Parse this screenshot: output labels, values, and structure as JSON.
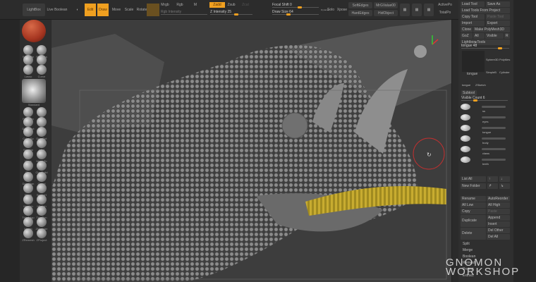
{
  "shelf": {
    "lightbox": "LightBox",
    "live_boolean": "Live Boolean",
    "edit": "Edit",
    "draw": "Draw",
    "move": "Move",
    "scale": "Scale",
    "rotate": "Rotate",
    "mrgb": "Mrgb",
    "rgb": "Rgb",
    "m": "M",
    "rgb_intensity": "Rgb Intensity",
    "zadd": "Zadd",
    "zsub": "Zsub",
    "zcut": "Zcut",
    "z_intensity": "Z Intensity 25",
    "focal_shift": "Focal Shift 0",
    "draw_size": "Draw Size 64",
    "dynamic": "Dynamic",
    "solo": "Solo",
    "xpose": "Xpose",
    "softedges": "SoftEdges",
    "hardedges": "HardEdges",
    "mrgvalue": "MrGValue00",
    "hidobject": "HidObject",
    "activepo": "ActivePo",
    "totalpo": "TotalPo"
  },
  "toolpanel": {
    "load_tool": "Load Tool",
    "save_as": "Save As",
    "load_from_project": "Load Tools From Project",
    "copy_tool": "Copy Tool",
    "paste_tool": "Paste Tool",
    "import": "Import",
    "export": "Export",
    "clone": "Clone",
    "make_polymesh": "Make PolyMesh3D",
    "goz": "GoZ",
    "all": "All",
    "visible": "Visible",
    "r": "R",
    "lightbox_tools": "Lightbox▸Tools",
    "tongue_slider": "tongue 48",
    "current_tool": "tongue",
    "tools": [
      "Sphere3D",
      "PolyMes",
      "SimpleB",
      "Cylinder",
      "tongue",
      "ZSketch"
    ],
    "subtool_header": "Subtool",
    "visible_count": "Visible Count 6",
    "subtools": [
      "",
      "ss",
      "eyes",
      "tongue",
      "body",
      "claws",
      "teeth"
    ],
    "list_all": "List All",
    "new_folder": "New Folder",
    "rename": "Rename",
    "autoreorder": "AutoReorder",
    "all_low": "All Low",
    "all_high": "All High",
    "copy": "Copy",
    "paste": "Paste",
    "duplicate": "Duplicate",
    "append": "Append",
    "insert": "Insert",
    "delete": "Delete",
    "del_other": "Del Other",
    "del_all": "Del All",
    "split": "Split",
    "merge": "Merge",
    "boolean": "Boolean",
    "remesh": "Remesh",
    "project": "Project",
    "extract": "Extract"
  },
  "brushes": [
    "SelectRe",
    "SelectLa",
    "Rect",
    "Circle",
    "Lasso",
    "Curve",
    "Standard",
    "FreeHan",
    "Dots",
    "DragRect",
    "Spray",
    "Color Sp",
    "DragDot",
    "Standar",
    "Inflat",
    "Move",
    "Move To",
    "Clay",
    "ClayBuild",
    "DamStan",
    "Chisel",
    "Pinch",
    "SnakeH",
    "Hpolish",
    "hPolish",
    "TrimAdap",
    "TrimDyn",
    "Morph",
    "ZModeler",
    "ZRemesh",
    "ZProject"
  ],
  "watermark": "GNOMON WORKSHOP",
  "colors": {
    "accent": "#f0a020",
    "material": "#b03a22"
  }
}
